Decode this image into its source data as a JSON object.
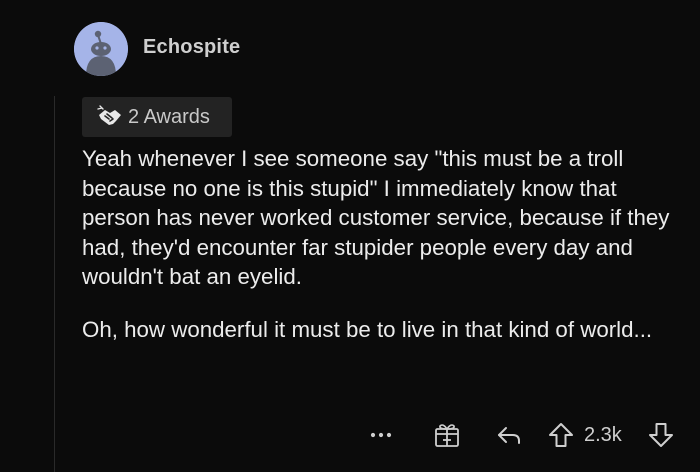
{
  "comment": {
    "author": "Echospite",
    "awards_label": "2 Awards",
    "paragraphs": [
      "Yeah whenever I see someone say \"this must be a troll because no one is this stupid\" I immediately know that person has never worked customer service, because if they had, they'd encounter far stupider people every day and wouldn't bat an eyelid.",
      "Oh, how wonderful it must be to live in that kind of world..."
    ],
    "actions": {
      "more_label": "•••",
      "score": "2.3k"
    }
  },
  "colors": {
    "background": "#0b0b0b",
    "avatar_bg": "#a5b4e8",
    "award_chip_bg": "#232323",
    "text": "#ececec",
    "muted_text": "#cfcfcf"
  },
  "icons": {
    "avatar": "reddit-snoo-avatar-icon",
    "award": "handshake-award-icon",
    "give_award": "gift-box-icon",
    "reply": "reply-arrow-icon",
    "upvote": "upvote-arrow-icon",
    "downvote": "downvote-arrow-icon"
  }
}
